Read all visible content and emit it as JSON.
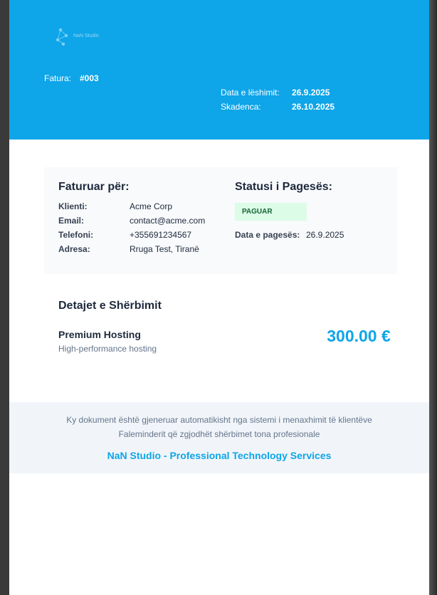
{
  "header": {
    "logo_text": "NaN Studio",
    "invoice_label": "Fatura:",
    "invoice_number": "#003",
    "issue_date_label": "Data e lëshimit:",
    "issue_date": "26.9.2025",
    "due_date_label": "Skadenca:",
    "due_date": "26.10.2025",
    "accent_color": "#0ea5e9"
  },
  "billed_to": {
    "title": "Faturuar për:",
    "rows": [
      {
        "label": "Klienti:",
        "value": "Acme Corp"
      },
      {
        "label": "Email:",
        "value": "contact@acme.com"
      },
      {
        "label": "Telefoni:",
        "value": "+355691234567"
      },
      {
        "label": "Adresa:",
        "value": "Rruga Test, Tiranë"
      }
    ]
  },
  "payment_status": {
    "title": "Statusi i Pagesës:",
    "badge": "PAGUAR",
    "badge_color": "#dcfce7",
    "date_label": "Data e pagesës:",
    "date": "26.9.2025"
  },
  "services": {
    "title": "Detajet e Shërbimit",
    "items": [
      {
        "name": "Premium Hosting",
        "description": "High-performance hosting",
        "price": "300.00 €"
      }
    ]
  },
  "footer": {
    "line1": "Ky dokument është gjeneruar automatikisht nga sistemi i menaxhimit të klientëve",
    "line2": "Faleminderit që zgjodhët shërbimet tona profesionale",
    "company": "NaN Studio - Professional Technology Services"
  }
}
